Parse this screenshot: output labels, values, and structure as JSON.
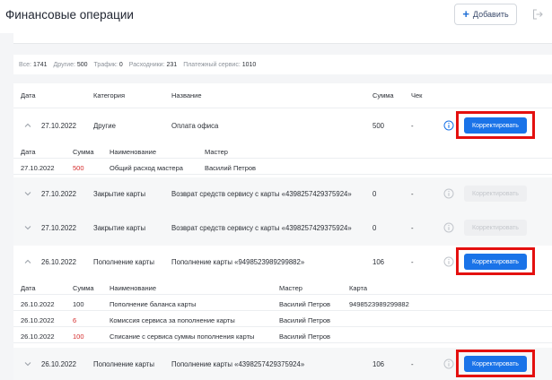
{
  "header": {
    "title": "Финансовые операции",
    "add_label": "Добавить"
  },
  "stats": {
    "all_label": "Все:",
    "all": "1741",
    "other_label": "Другие:",
    "other": "500",
    "traffic_label": "Трафик:",
    "traffic": "0",
    "expenses_label": "Расходники:",
    "expenses": "231",
    "payment_label": "Платежный сервис:",
    "payment": "1010"
  },
  "columns": {
    "date": "Дата",
    "category": "Категория",
    "name": "Название",
    "sum": "Сумма",
    "check": "Чек"
  },
  "rows": [
    {
      "date": "27.10.2022",
      "category": "Другие",
      "name": "Оплата офиса",
      "sum": "500",
      "check": "-",
      "action": "Корректировать"
    },
    {
      "date": "27.10.2022",
      "category": "Закрытие карты",
      "name": "Возврат средств сервису с карты «4398257429375924»",
      "sum": "0",
      "check": "-",
      "action": "Корректировать"
    },
    {
      "date": "27.10.2022",
      "category": "Закрытие карты",
      "name": "Возврат средств сервису с карты «4398257429375924»",
      "sum": "0",
      "check": "-",
      "action": "Корректировать"
    },
    {
      "date": "26.10.2022",
      "category": "Пополнение карты",
      "name": "Пополнение карты «9498523989299882»",
      "sum": "106",
      "check": "-",
      "action": "Корректировать"
    },
    {
      "date": "26.10.2022",
      "category": "Пополнение карты",
      "name": "Пополнение карты «4398257429375924»",
      "sum": "106",
      "check": "-",
      "action": "Корректировать"
    }
  ],
  "sub1": {
    "headers": {
      "date": "Дата",
      "sum": "Сумма",
      "name": "Наименование",
      "master": "Мастер"
    },
    "items": [
      {
        "date": "27.10.2022",
        "sum": "500",
        "name": "Общий расход мастера",
        "master": "Василий Петров"
      }
    ]
  },
  "sub2": {
    "headers": {
      "date": "Дата",
      "sum": "Сумма",
      "name": "Наименование",
      "master": "Мастер",
      "card": "Карта"
    },
    "items": [
      {
        "date": "26.10.2022",
        "sum": "100",
        "name": "Пополнение баланса карты",
        "master": "Василий Петров",
        "card": "9498523989299882"
      },
      {
        "date": "26.10.2022",
        "sum": "6",
        "name": "Комиссия сервиса за пополнение карты",
        "master": "Василий Петров",
        "card": ""
      },
      {
        "date": "26.10.2022",
        "sum": "100",
        "name": "Списание с сервиса суммы пополнения карты",
        "master": "Василий Петров",
        "card": ""
      }
    ]
  },
  "colors": {
    "accent": "#1a73e8",
    "highlight": "#e4100f",
    "negative": "#d52b2b"
  }
}
